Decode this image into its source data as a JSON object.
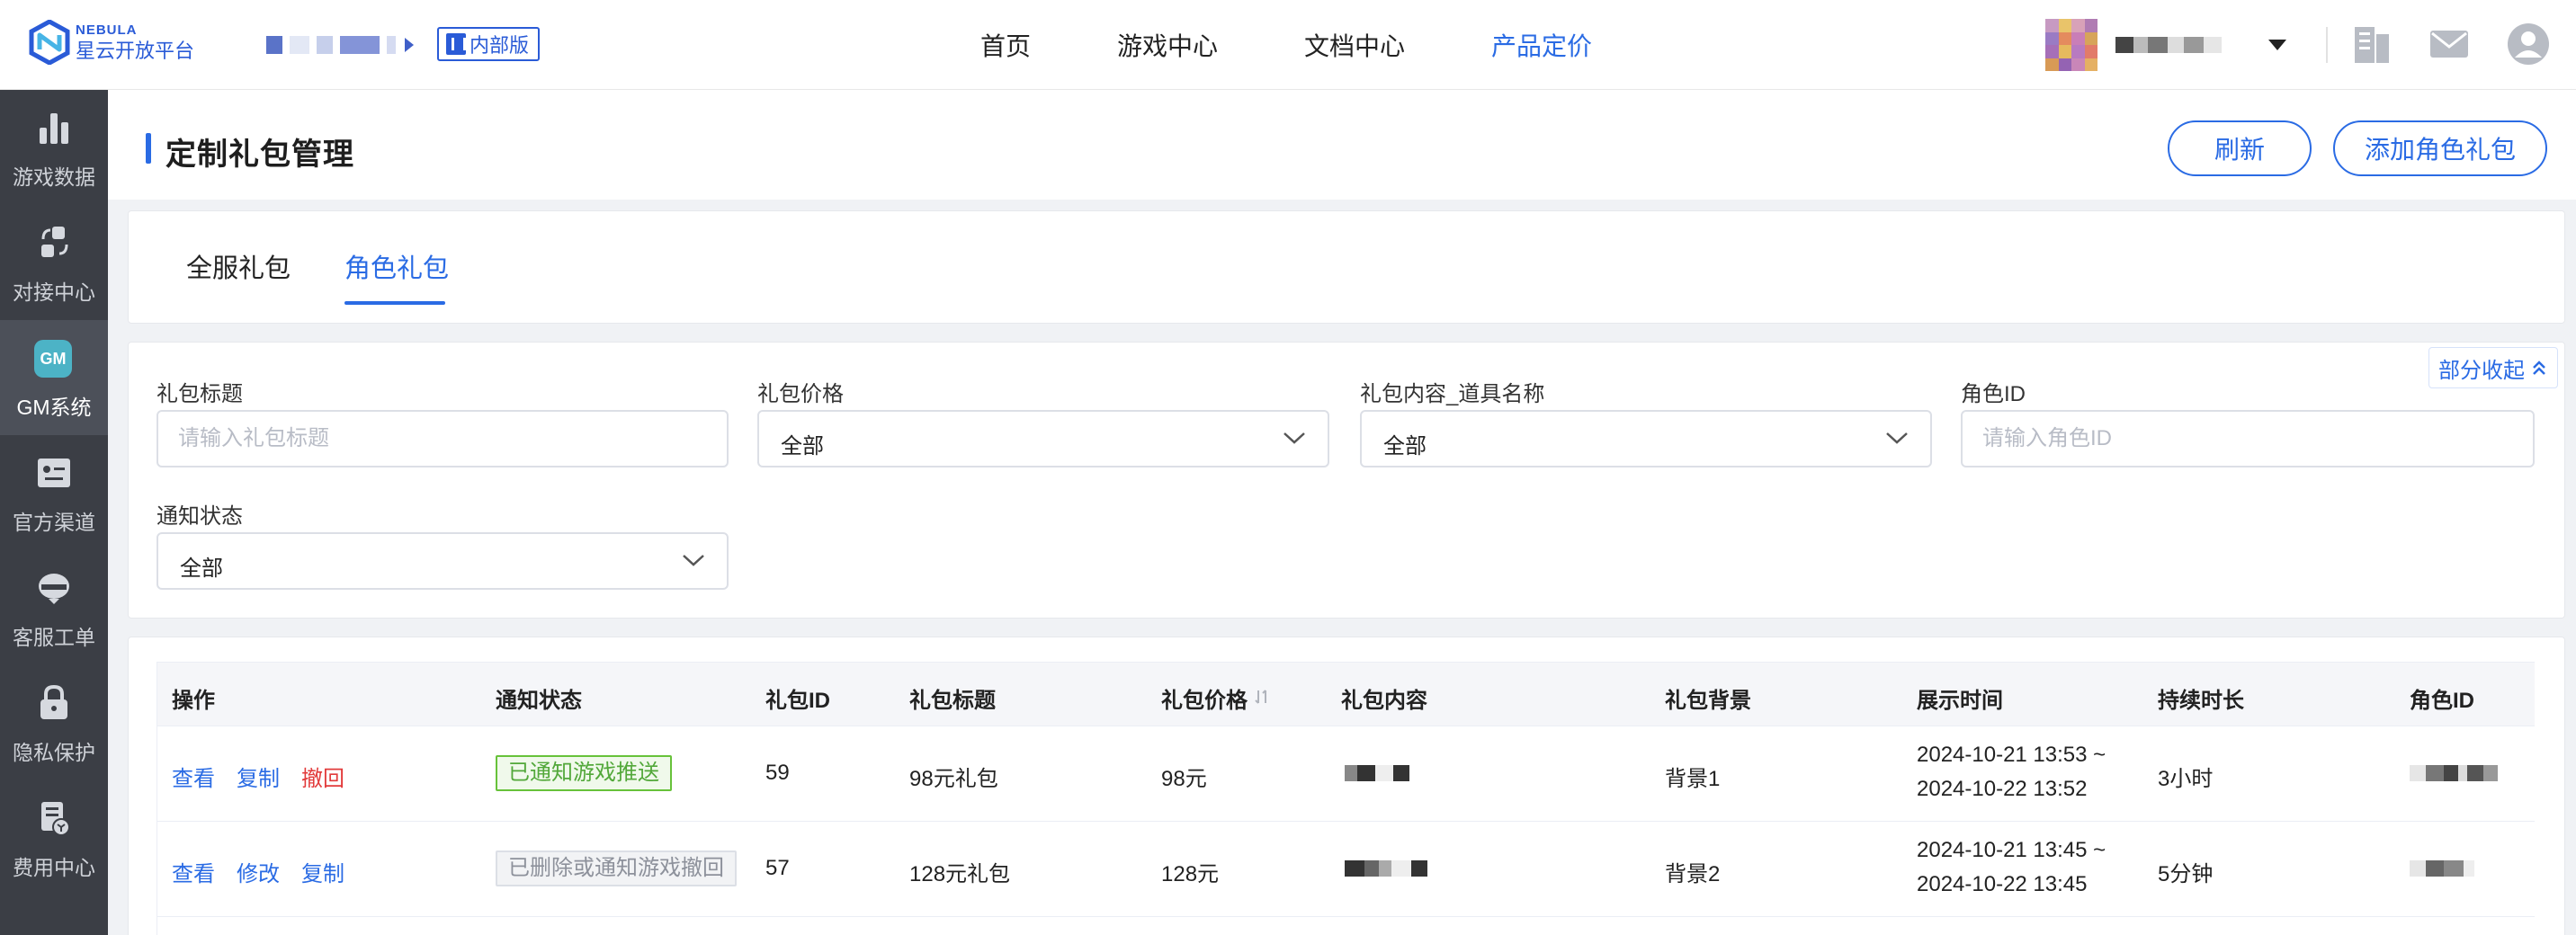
{
  "brand": {
    "en": "NEBULA",
    "cn": "星云开放平台",
    "badge": "内部版"
  },
  "nav": {
    "items": [
      "首页",
      "游戏中心",
      "文档中心",
      "产品定价"
    ],
    "active_index": 3
  },
  "sidebar": {
    "items": [
      {
        "label": "游戏数据",
        "icon": "bar-chart-icon"
      },
      {
        "label": "对接中心",
        "icon": "exchange-icon"
      },
      {
        "label": "GM系统",
        "icon": "gm-icon",
        "badge": "GM"
      },
      {
        "label": "官方渠道",
        "icon": "id-card-icon"
      },
      {
        "label": "客服工单",
        "icon": "headset-icon"
      },
      {
        "label": "隐私保护",
        "icon": "lock-icon"
      },
      {
        "label": "费用中心",
        "icon": "billing-icon"
      }
    ],
    "active_index": 2
  },
  "page": {
    "title": "定制礼包管理",
    "refresh_label": "刷新",
    "add_label": "添加角色礼包"
  },
  "tabs": {
    "items": [
      "全服礼包",
      "角色礼包"
    ],
    "active_index": 1
  },
  "filters": {
    "collapse_label": "部分收起",
    "title": {
      "label": "礼包标题",
      "placeholder": "请输入礼包标题"
    },
    "price": {
      "label": "礼包价格",
      "value": "全部"
    },
    "item_name": {
      "label": "礼包内容_道具名称",
      "value": "全部"
    },
    "role_id": {
      "label": "角色ID",
      "placeholder": "请输入角色ID"
    },
    "notify_status": {
      "label": "通知状态",
      "value": "全部"
    }
  },
  "table": {
    "columns": [
      "操作",
      "通知状态",
      "礼包ID",
      "礼包标题",
      "礼包价格",
      "礼包内容",
      "礼包背景",
      "展示时间",
      "持续时长",
      "角色ID"
    ],
    "rows": [
      {
        "actions": [
          "查看",
          "复制",
          "撤回"
        ],
        "status": "已通知游戏推送",
        "id": "59",
        "title": "98元礼包",
        "price": "98元",
        "background": "背景1",
        "time_start": "2024-10-21 13:53 ~",
        "time_end": "2024-10-22 13:52",
        "duration": "3小时"
      },
      {
        "actions": [
          "查看",
          "修改",
          "复制"
        ],
        "status": "已删除或通知游戏撤回",
        "id": "57",
        "title": "128元礼包",
        "price": "128元",
        "background": "背景2",
        "time_start": "2024-10-21 13:45 ~",
        "time_end": "2024-10-22 13:45",
        "duration": "5分钟"
      }
    ]
  },
  "colors": {
    "primary": "#2a6be4",
    "sidebar_bg": "#3b3e45",
    "success": "#67c23a",
    "danger": "#e23b3b"
  }
}
